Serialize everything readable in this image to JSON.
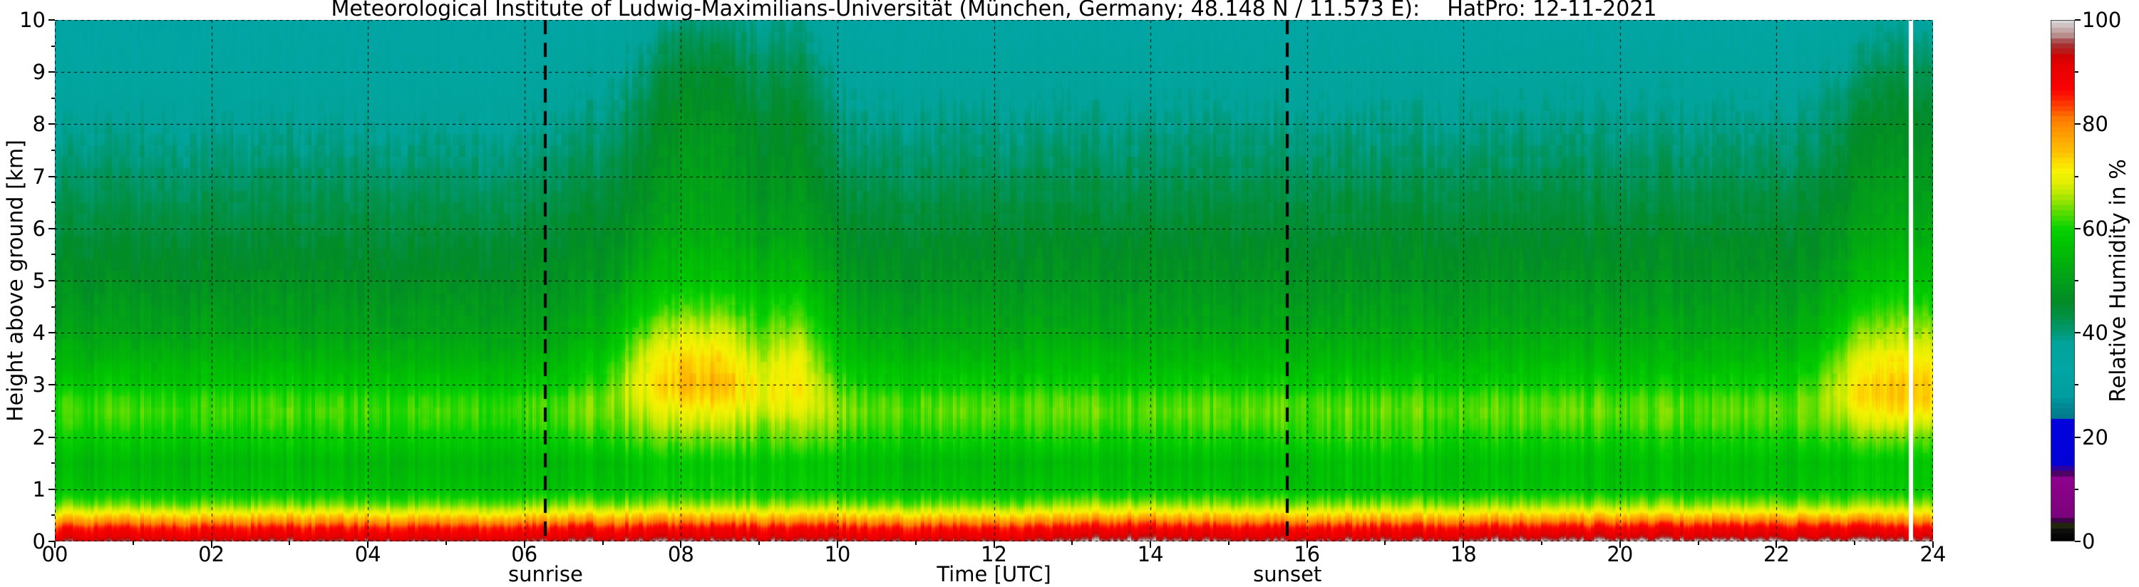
{
  "figure": {
    "title": "Meteorological Institute of Ludwig-Maximilians-Universität (München, Germany; 48.148 N / 11.573 E):    HatPro: 12-11-2021",
    "background_color": "#ffffff"
  },
  "axes": {
    "x": {
      "label": "Time [UTC]",
      "min": 0,
      "max": 24,
      "tick_values": [
        0,
        2,
        4,
        6,
        8,
        10,
        12,
        14,
        16,
        18,
        20,
        22,
        24
      ],
      "tick_labels": [
        "00",
        "02",
        "04",
        "06",
        "08",
        "10",
        "12",
        "14",
        "16",
        "18",
        "20",
        "22",
        "24"
      ],
      "minor_tick_values": [
        1,
        3,
        5,
        7,
        9,
        11,
        13,
        15,
        17,
        19,
        21,
        23
      ]
    },
    "y": {
      "label": "Height above ground [km]",
      "min": 0,
      "max": 10,
      "tick_values": [
        0,
        1,
        2,
        3,
        4,
        5,
        6,
        7,
        8,
        9,
        10
      ],
      "tick_labels": [
        "0",
        "1",
        "2",
        "3",
        "4",
        "5",
        "6",
        "7",
        "8",
        "9",
        "10"
      ],
      "minor_tick_values": [
        0.5,
        1.5,
        2.5,
        3.5,
        4.5,
        5.5,
        6.5,
        7.5,
        8.5,
        9.5
      ]
    },
    "grid": {
      "show": true,
      "style": "dashed",
      "color": "#000000"
    }
  },
  "colorbar": {
    "label": "Relative Humidity in %",
    "min": 0,
    "max": 100,
    "tick_values": [
      0,
      20,
      40,
      60,
      80,
      100
    ],
    "tick_labels": [
      "0",
      "20",
      "40",
      "60",
      "80",
      "100"
    ],
    "minor_tick_values": [
      10,
      30,
      50,
      70,
      90
    ],
    "stops": [
      [
        0,
        "#000000"
      ],
      [
        2,
        "#0d0d0d"
      ],
      [
        3,
        "#20260e"
      ],
      [
        4,
        "#3f0347"
      ],
      [
        5,
        "#7c017c"
      ],
      [
        12,
        "#8e018e"
      ],
      [
        13,
        "#500166"
      ],
      [
        14,
        "#2d00a0"
      ],
      [
        15,
        "#0202d6"
      ],
      [
        23,
        "#0202de"
      ],
      [
        24,
        "#017b8d"
      ],
      [
        26,
        "#018a96"
      ],
      [
        28,
        "#019da0"
      ],
      [
        33,
        "#02a6a4"
      ],
      [
        38,
        "#02a39a"
      ],
      [
        40,
        "#019a78"
      ],
      [
        43,
        "#029146"
      ],
      [
        46,
        "#038b26"
      ],
      [
        50,
        "#029f1b"
      ],
      [
        54,
        "#02b40a"
      ],
      [
        58,
        "#01c801"
      ],
      [
        60,
        "#0bd201"
      ],
      [
        63,
        "#55dc01"
      ],
      [
        65,
        "#8ee301"
      ],
      [
        67,
        "#c0ea02"
      ],
      [
        69,
        "#e4ef02"
      ],
      [
        71,
        "#f7f201"
      ],
      [
        73,
        "#fdd801"
      ],
      [
        75,
        "#febc01"
      ],
      [
        77,
        "#fea801"
      ],
      [
        79,
        "#fe9201"
      ],
      [
        81,
        "#fe7a01"
      ],
      [
        83,
        "#fe4a01"
      ],
      [
        85,
        "#fe1e01"
      ],
      [
        87,
        "#f90101"
      ],
      [
        91,
        "#e80101"
      ],
      [
        93,
        "#d20101"
      ],
      [
        94,
        "#bb1818"
      ],
      [
        95,
        "#aa2e2e"
      ],
      [
        96,
        "#a85252"
      ],
      [
        97,
        "#b98c8c"
      ],
      [
        98,
        "#c4a8a8"
      ],
      [
        99,
        "#cfc3c3"
      ],
      [
        100,
        "#dcdcdc"
      ]
    ]
  },
  "annotations": {
    "sunrise": {
      "label": "sunrise",
      "time_utc": 6.27
    },
    "sunset": {
      "label": "sunset",
      "time_utc": 15.75
    }
  },
  "chart_data": {
    "type": "heatmap",
    "title": "Meteorological Institute of Ludwig-Maximilians-Universität (München, Germany; 48.148 N / 11.573 E):    HatPro: 12-11-2021",
    "xlabel": "Time [UTC]",
    "ylabel": "Height above ground [km]",
    "zlabel": "Relative Humidity in %",
    "xlim": [
      0,
      24
    ],
    "ylim": [
      0,
      10
    ],
    "zlim": [
      0,
      100
    ],
    "data_gap_time_utc": 23.72,
    "x_hours": [
      0,
      0.5,
      1,
      1.5,
      2,
      2.5,
      3,
      3.5,
      4,
      4.5,
      5,
      5.5,
      6,
      6.5,
      7,
      7.5,
      8,
      8.5,
      9,
      9.5,
      10,
      10.5,
      11,
      11.5,
      12,
      12.5,
      13,
      13.5,
      14,
      14.5,
      15,
      15.5,
      16,
      16.5,
      17,
      17.5,
      18,
      18.5,
      19,
      19.5,
      20,
      20.5,
      21,
      21.5,
      22,
      22.5,
      23,
      23.5,
      24
    ],
    "y_km": [
      0,
      0.1,
      0.25,
      0.4,
      0.55,
      0.7,
      0.85,
      1,
      1.5,
      2,
      2.25,
      2.5,
      2.75,
      3,
      3.5,
      4,
      4.5,
      5,
      6,
      7,
      8,
      9,
      10
    ],
    "rh_percent": [
      [
        95,
        95,
        95,
        95,
        95,
        95,
        95,
        95,
        95,
        95,
        95,
        95,
        95,
        96,
        96,
        96,
        96,
        96,
        96,
        96,
        96,
        95,
        95,
        95,
        95,
        95,
        96,
        98,
        98,
        96,
        96,
        96,
        96,
        96,
        96,
        96,
        97,
        97,
        97,
        97,
        98,
        98,
        98,
        98,
        98,
        98,
        98,
        98,
        98
      ],
      [
        90,
        90,
        90,
        90,
        90,
        90,
        90,
        90,
        90,
        90,
        90,
        90,
        90,
        91,
        91,
        91,
        91,
        91,
        91,
        91,
        91,
        90,
        90,
        90,
        90,
        90,
        91,
        93,
        93,
        91,
        91,
        91,
        91,
        91,
        91,
        91,
        92,
        92,
        92,
        92,
        92,
        92,
        92,
        92,
        92,
        92,
        92,
        93,
        93
      ],
      [
        86,
        86,
        86,
        86,
        86,
        86,
        86,
        86,
        86,
        86,
        86,
        86,
        86,
        87,
        87,
        87,
        87,
        87,
        87,
        87,
        87,
        86,
        86,
        86,
        86,
        86,
        87,
        88,
        88,
        87,
        87,
        87,
        87,
        87,
        87,
        87,
        87,
        87,
        87,
        87,
        88,
        88,
        88,
        88,
        88,
        88,
        88,
        88,
        88
      ],
      [
        78,
        78,
        78,
        78,
        78,
        78,
        78,
        78,
        78,
        78,
        78,
        78,
        78,
        79,
        79,
        79,
        79,
        79,
        79,
        79,
        79,
        78,
        78,
        78,
        78,
        78,
        79,
        81,
        81,
        79,
        79,
        79,
        79,
        79,
        79,
        79,
        79,
        79,
        79,
        79,
        80,
        80,
        80,
        80,
        80,
        80,
        80,
        80,
        80
      ],
      [
        70,
        70,
        70,
        70,
        70,
        70,
        70,
        70,
        70,
        70,
        70,
        70,
        70,
        71,
        71,
        71,
        71,
        71,
        71,
        71,
        71,
        70,
        70,
        70,
        70,
        70,
        71,
        72,
        72,
        71,
        71,
        71,
        71,
        71,
        71,
        71,
        71,
        71,
        71,
        71,
        71,
        71,
        71,
        71,
        71,
        71,
        71,
        72,
        72
      ],
      [
        64,
        64,
        64,
        64,
        64,
        64,
        64,
        64,
        64,
        64,
        64,
        64,
        64,
        65,
        65,
        65,
        65,
        65,
        65,
        65,
        65,
        64,
        64,
        64,
        64,
        64,
        65,
        66,
        66,
        65,
        65,
        65,
        65,
        65,
        65,
        65,
        65,
        65,
        65,
        65,
        65,
        65,
        65,
        65,
        65,
        65,
        65,
        66,
        66
      ],
      [
        60,
        60,
        60,
        60,
        60,
        60,
        60,
        60,
        60,
        60,
        60,
        60,
        60,
        61,
        61,
        61,
        61,
        61,
        61,
        61,
        61,
        60,
        60,
        60,
        60,
        60,
        61,
        61,
        61,
        61,
        61,
        61,
        61,
        61,
        61,
        61,
        61,
        61,
        61,
        61,
        61,
        61,
        61,
        61,
        61,
        61,
        61,
        62,
        62
      ],
      [
        57,
        57,
        57,
        57,
        57,
        57,
        57,
        57,
        57,
        57,
        57,
        57,
        57,
        57,
        58,
        58,
        59,
        59,
        59,
        59,
        58,
        57,
        57,
        57,
        57,
        57,
        57,
        58,
        58,
        57,
        57,
        57,
        57,
        57,
        57,
        57,
        57,
        57,
        57,
        57,
        57,
        57,
        57,
        57,
        57,
        58,
        58,
        59,
        59
      ],
      [
        55,
        55,
        55,
        55,
        55,
        55,
        55,
        55,
        55,
        55,
        55,
        55,
        55,
        55,
        56,
        57,
        58,
        58,
        58,
        58,
        57,
        56,
        55,
        55,
        55,
        55,
        55,
        56,
        56,
        55,
        55,
        55,
        56,
        57,
        57,
        57,
        56,
        56,
        56,
        56,
        56,
        56,
        56,
        56,
        56,
        56,
        57,
        58,
        58
      ],
      [
        59,
        59,
        59,
        59,
        59,
        59,
        59,
        59,
        59,
        59,
        59,
        59,
        59,
        60,
        61,
        63,
        64,
        64,
        63,
        64,
        62,
        60,
        60,
        60,
        60,
        60,
        60,
        60,
        60,
        60,
        60,
        60,
        61,
        61,
        61,
        61,
        60,
        60,
        60,
        60,
        60,
        60,
        60,
        60,
        60,
        61,
        63,
        65,
        64
      ],
      [
        61,
        61,
        61,
        61,
        61,
        61,
        61,
        61,
        61,
        61,
        61,
        61,
        61,
        62,
        63,
        65,
        67,
        67,
        65,
        66,
        64,
        62,
        62,
        62,
        62,
        62,
        62,
        62,
        62,
        62,
        62,
        62,
        62,
        62,
        62,
        62,
        62,
        62,
        62,
        62,
        62,
        62,
        62,
        62,
        62,
        63,
        66,
        69,
        68
      ],
      [
        62,
        62,
        62,
        62,
        62,
        62,
        62,
        62,
        62,
        62,
        62,
        62,
        62,
        63,
        64,
        67,
        70,
        70,
        68,
        69,
        65,
        63,
        63,
        63,
        63,
        63,
        63,
        63,
        63,
        63,
        63,
        63,
        63,
        63,
        63,
        63,
        63,
        63,
        63,
        63,
        63,
        63,
        63,
        63,
        63,
        64,
        69,
        73,
        72
      ],
      [
        61,
        61,
        61,
        61,
        61,
        61,
        61,
        61,
        61,
        61,
        61,
        61,
        61,
        62,
        64,
        69,
        73,
        73,
        70,
        71,
        64,
        62,
        62,
        62,
        62,
        62,
        62,
        62,
        62,
        62,
        62,
        62,
        62,
        62,
        62,
        62,
        62,
        62,
        62,
        62,
        62,
        62,
        62,
        62,
        62,
        64,
        71,
        75,
        74
      ],
      [
        58,
        58,
        58,
        58,
        58,
        58,
        58,
        58,
        58,
        58,
        58,
        58,
        58,
        59,
        62,
        70,
        75,
        75,
        70,
        72,
        62,
        59,
        59,
        59,
        59,
        59,
        59,
        59,
        59,
        59,
        59,
        59,
        59,
        59,
        59,
        59,
        59,
        59,
        59,
        59,
        59,
        59,
        59,
        59,
        59,
        62,
        71,
        75,
        74
      ],
      [
        54,
        54,
        54,
        54,
        54,
        54,
        54,
        54,
        54,
        54,
        54,
        54,
        54,
        55,
        58,
        68,
        73,
        73,
        67,
        70,
        58,
        55,
        55,
        55,
        55,
        55,
        55,
        55,
        55,
        55,
        55,
        55,
        55,
        55,
        55,
        55,
        55,
        55,
        55,
        55,
        55,
        55,
        55,
        55,
        55,
        58,
        68,
        72,
        71
      ],
      [
        51,
        51,
        51,
        51,
        51,
        51,
        51,
        51,
        51,
        51,
        51,
        51,
        51,
        52,
        54,
        63,
        68,
        68,
        63,
        66,
        55,
        52,
        52,
        52,
        52,
        52,
        52,
        52,
        52,
        52,
        52,
        52,
        52,
        52,
        52,
        52,
        52,
        52,
        52,
        52,
        52,
        52,
        52,
        52,
        52,
        54,
        63,
        67,
        66
      ],
      [
        49,
        49,
        49,
        49,
        49,
        49,
        49,
        49,
        49,
        49,
        49,
        49,
        49,
        50,
        52,
        58,
        62,
        62,
        59,
        61,
        52,
        50,
        50,
        50,
        50,
        50,
        50,
        50,
        50,
        50,
        50,
        50,
        50,
        50,
        50,
        50,
        50,
        50,
        50,
        50,
        50,
        50,
        50,
        50,
        50,
        52,
        58,
        62,
        61
      ],
      [
        47,
        47,
        47,
        47,
        47,
        47,
        47,
        47,
        47,
        47,
        47,
        47,
        47,
        48,
        49,
        54,
        57,
        57,
        55,
        56,
        50,
        48,
        48,
        48,
        48,
        48,
        48,
        48,
        48,
        48,
        48,
        48,
        48,
        48,
        48,
        48,
        48,
        48,
        48,
        48,
        48,
        48,
        48,
        48,
        48,
        49,
        54,
        58,
        57
      ],
      [
        44,
        44,
        44,
        44,
        44,
        44,
        44,
        44,
        44,
        44,
        44,
        44,
        44,
        45,
        46,
        49,
        52,
        52,
        50,
        51,
        46,
        45,
        45,
        45,
        45,
        45,
        45,
        45,
        45,
        45,
        45,
        45,
        45,
        45,
        45,
        45,
        45,
        45,
        45,
        45,
        45,
        45,
        45,
        45,
        45,
        46,
        50,
        53,
        52
      ],
      [
        41,
        41,
        41,
        41,
        41,
        41,
        41,
        41,
        41,
        41,
        41,
        41,
        41,
        42,
        43,
        46,
        50,
        50,
        47,
        48,
        43,
        42,
        42,
        42,
        42,
        42,
        42,
        42,
        42,
        42,
        42,
        42,
        42,
        42,
        42,
        42,
        42,
        42,
        42,
        42,
        42,
        42,
        42,
        42,
        42,
        43,
        47,
        50,
        49
      ],
      [
        38,
        38,
        38,
        38,
        38,
        38,
        38,
        38,
        38,
        38,
        38,
        38,
        38,
        39,
        40,
        43,
        48,
        48,
        45,
        46,
        40,
        39,
        39,
        39,
        39,
        39,
        39,
        39,
        39,
        39,
        39,
        39,
        39,
        39,
        39,
        39,
        39,
        39,
        39,
        39,
        39,
        39,
        39,
        39,
        39,
        40,
        44,
        47,
        46
      ],
      [
        35,
        35,
        35,
        35,
        35,
        35,
        35,
        35,
        35,
        35,
        35,
        35,
        35,
        36,
        37,
        40,
        45,
        45,
        42,
        43,
        37,
        36,
        36,
        36,
        36,
        36,
        36,
        36,
        36,
        36,
        36,
        36,
        36,
        36,
        36,
        36,
        36,
        36,
        36,
        36,
        36,
        36,
        36,
        36,
        36,
        37,
        40,
        43,
        42
      ],
      [
        32,
        32,
        32,
        32,
        32,
        33,
        33,
        33,
        33,
        33,
        33,
        33,
        33,
        33,
        34,
        36,
        40,
        40,
        38,
        39,
        34,
        33,
        33,
        33,
        33,
        33,
        33,
        33,
        33,
        33,
        33,
        33,
        33,
        33,
        33,
        33,
        33,
        33,
        33,
        33,
        33,
        33,
        33,
        33,
        33,
        34,
        36,
        38,
        37
      ]
    ]
  }
}
